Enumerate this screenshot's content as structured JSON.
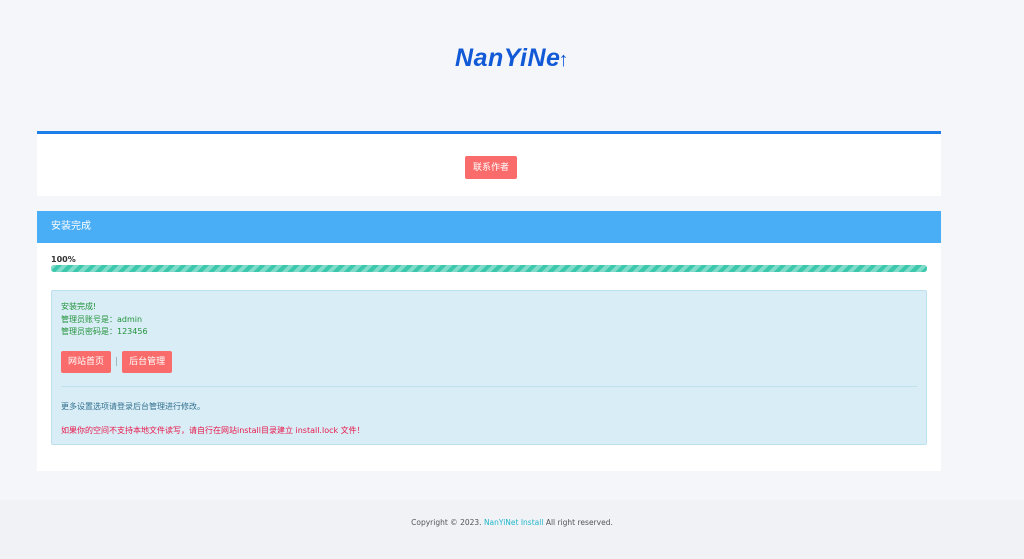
{
  "brand": {
    "logo_text": "NanYiNe",
    "logo_arrow": "↑",
    "color": "#1159d6"
  },
  "top_card": {
    "contact_button": "联系作者",
    "accent": "#1e7ee8"
  },
  "main_card": {
    "header_title": "安装完成",
    "progress": {
      "label": "100%",
      "percent": 100
    },
    "info": {
      "complete_text": "安装完成!",
      "admin_account": "管理员账号是：admin",
      "admin_password": "管理员密码是：123456",
      "home_button": "网站首页",
      "separator": "|",
      "admin_button": "后台管理",
      "note": "更多设置选项请登录后台管理进行修改。",
      "warning": "如果你的空间不支持本地文件读写，请自行在网站install目录建立 install.lock 文件！"
    }
  },
  "footer": {
    "prefix": "Copyright © 2023.",
    "link": "NanYiNet Install",
    "suffix": "All right reserved."
  },
  "colors": {
    "header_blue": "#4aaef6",
    "button_red": "#fa6c6c",
    "progress_green": "#3cc8ad",
    "info_bg": "#d9edf7",
    "warning_red": "#e8194a"
  }
}
